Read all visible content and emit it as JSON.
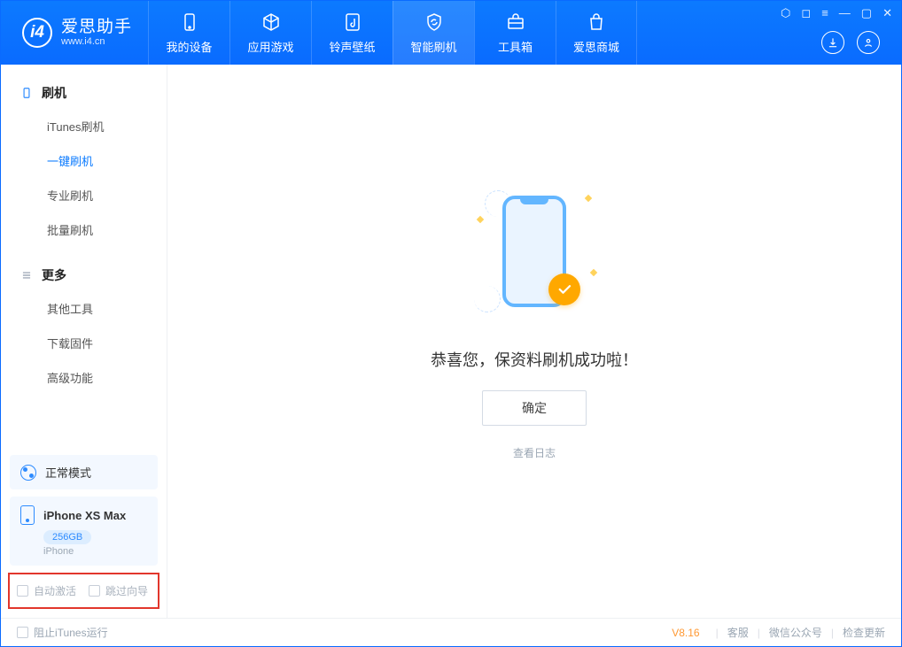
{
  "app": {
    "name_cn": "爱思助手",
    "url": "www.i4.cn"
  },
  "nav": {
    "items": [
      {
        "label": "我的设备"
      },
      {
        "label": "应用游戏"
      },
      {
        "label": "铃声壁纸"
      },
      {
        "label": "智能刷机"
      },
      {
        "label": "工具箱"
      },
      {
        "label": "爱思商城"
      }
    ]
  },
  "sidebar": {
    "section1": {
      "title": "刷机",
      "items": [
        "iTunes刷机",
        "一键刷机",
        "专业刷机",
        "批量刷机"
      ]
    },
    "section2": {
      "title": "更多",
      "items": [
        "其他工具",
        "下载固件",
        "高级功能"
      ]
    },
    "mode": "正常模式",
    "device": {
      "name": "iPhone XS Max",
      "storage": "256GB",
      "type": "iPhone"
    },
    "auto_activate": "自动激活",
    "skip_guide": "跳过向导"
  },
  "main": {
    "message": "恭喜您，保资料刷机成功啦！",
    "ok": "确定",
    "view_log": "查看日志"
  },
  "footer": {
    "block_itunes": "阻止iTunes运行",
    "version": "V8.16",
    "support": "客服",
    "wechat": "微信公众号",
    "check_update": "检查更新"
  }
}
